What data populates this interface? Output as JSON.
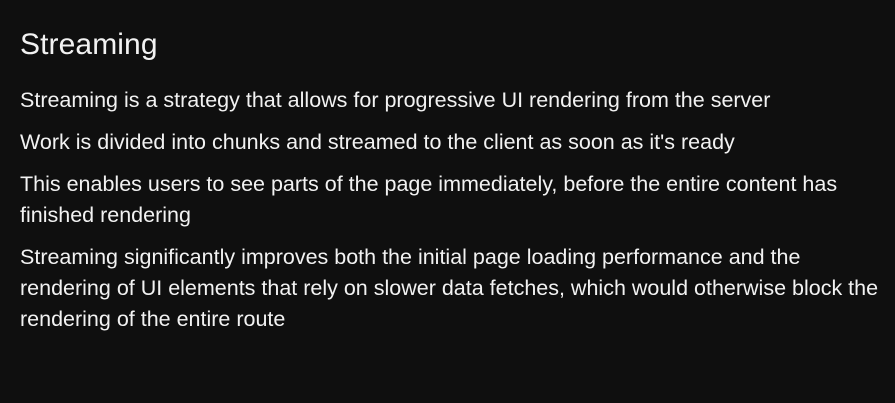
{
  "slide": {
    "title": "Streaming",
    "points": [
      "Streaming is a strategy that allows for progressive UI rendering from the server",
      "Work is divided into chunks and streamed to the client as soon as it's ready",
      "This enables users to see parts of the page immediately, before the entire content has finished rendering",
      "Streaming significantly improves both the initial page loading performance and the rendering of UI elements that rely on slower data fetches, which would otherwise block the rendering of the entire route"
    ]
  },
  "colors": {
    "background": "#0f0f0f",
    "text": "#f2f2f2"
  }
}
